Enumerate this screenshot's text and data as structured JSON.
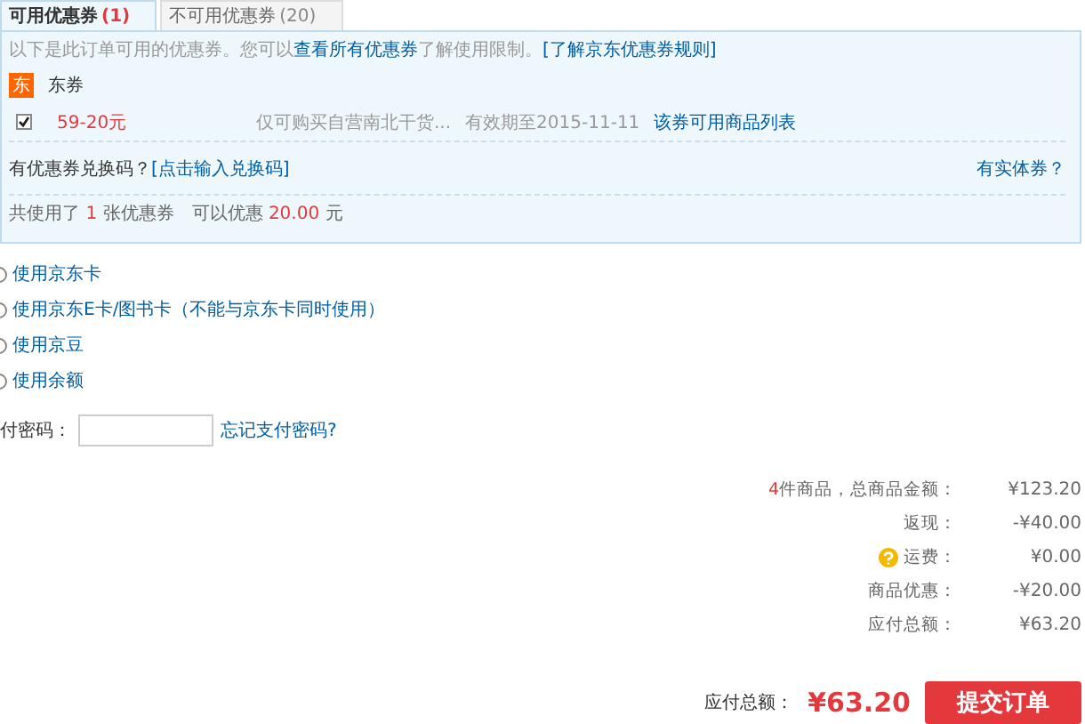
{
  "tabs": [
    {
      "label": "可用优惠券",
      "count": "(1)",
      "selected": true
    },
    {
      "label": "不可用优惠券",
      "count": "(20)",
      "selected": false
    }
  ],
  "coupon_panel": {
    "intro_before": "以下是此订单可用的优惠券。您可以",
    "intro_link": "查看所有优惠券",
    "intro_after": "了解使用限制。",
    "rules_link": "[了解京东优惠券规则]",
    "group": {
      "badge": "东",
      "title": "东券"
    },
    "coupons": [
      {
        "checked": true,
        "amount": "59-20元",
        "scope": "仅可购买自营南北干货...",
        "validity": "有效期至2015-11-11",
        "link": "该券可用商品列表"
      }
    ],
    "exchange_label": "有优惠券兑换码？",
    "exchange_link": "[点击输入兑换码]",
    "physical_link": "有实体券？",
    "summary": {
      "before": "共使用了",
      "count": "1",
      "middle": "张优惠券　可以优惠",
      "amount": "20.00",
      "after": "元"
    }
  },
  "payment_options": [
    {
      "label": "使用京东卡",
      "selected": false
    },
    {
      "label": "使用京东E卡/图书卡（不能与京东卡同时使用）",
      "selected": false
    },
    {
      "label": "使用京豆",
      "selected": false
    },
    {
      "label": "使用余额",
      "selected": false
    }
  ],
  "password": {
    "label": "付密码：",
    "forgot_link": "忘记支付密码?"
  },
  "totals": [
    {
      "kind": "count",
      "count": "4",
      "label": "件商品，总商品金额：",
      "value": "¥123.20"
    },
    {
      "kind": "plain",
      "label": "返现：",
      "value": "-¥40.00"
    },
    {
      "kind": "help",
      "label": "运费：",
      "value": "¥0.00"
    },
    {
      "kind": "plain",
      "label": "商品优惠：",
      "value": "-¥20.00"
    },
    {
      "kind": "plain",
      "label": "应付总额：",
      "value": "¥63.20"
    }
  ],
  "footer": {
    "label": "应付总额：",
    "amount": "¥63.20",
    "submit": "提交订单"
  }
}
